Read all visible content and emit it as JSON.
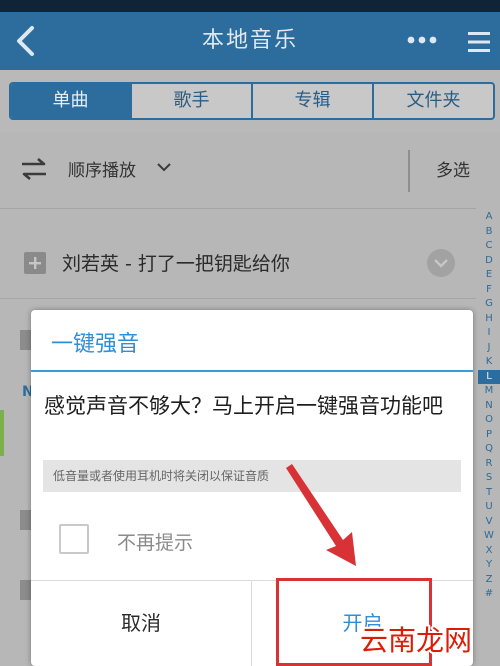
{
  "header": {
    "title": "本地音乐",
    "back_icon": "back-arrow-icon",
    "more_icon": "more-dots-icon",
    "menu_icon": "menu-icon"
  },
  "tabs": [
    {
      "label": "单曲",
      "active": true
    },
    {
      "label": "歌手",
      "active": false
    },
    {
      "label": "专辑",
      "active": false
    },
    {
      "label": "文件夹",
      "active": false
    }
  ],
  "toolbar": {
    "order_label": "顺序播放",
    "multi_select_label": "多选"
  },
  "song": {
    "title": "刘若英 - 打了一把钥匙给你"
  },
  "list": {
    "section_letter": "N"
  },
  "az_index": [
    "A",
    "B",
    "C",
    "D",
    "E",
    "F",
    "G",
    "H",
    "I",
    "J",
    "K",
    "L",
    "M",
    "N",
    "O",
    "P",
    "Q",
    "R",
    "S",
    "T",
    "U",
    "V",
    "W",
    "X",
    "Y",
    "Z",
    "#"
  ],
  "az_active": "L",
  "dialog": {
    "title": "一键强音",
    "message": "感觉声音不够大？马上开启一键强音功能吧",
    "hint": "低音量或者使用耳机时将关闭以保证音质",
    "checkbox_label": "不再提示",
    "cancel_label": "取消",
    "confirm_label": "开启"
  },
  "watermark": {
    "text": "云南龙网"
  },
  "colors": {
    "header": "#2c6d9e",
    "accent": "#2f8fd6",
    "annotation": "#d93236",
    "watermark": "#d81e06"
  }
}
